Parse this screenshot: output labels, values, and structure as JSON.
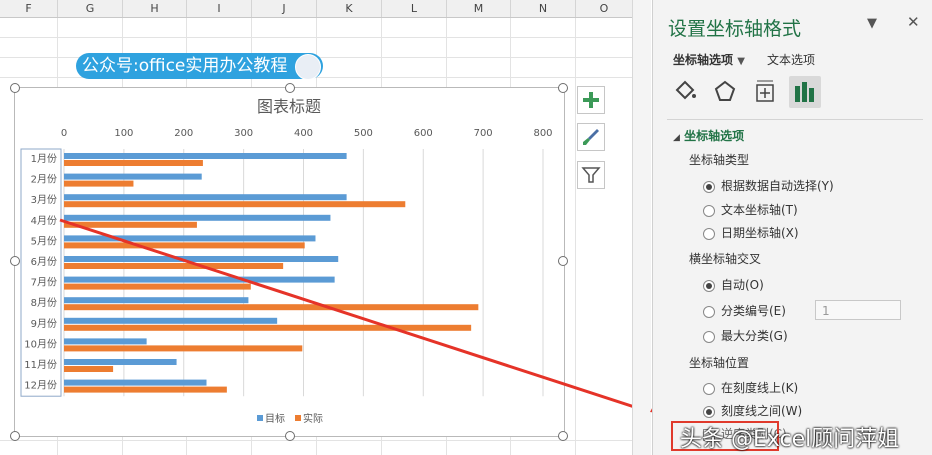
{
  "sheet": {
    "columns": [
      "F",
      "G",
      "H",
      "I",
      "J",
      "K",
      "L",
      "M",
      "N",
      "O"
    ]
  },
  "banner": {
    "text": "公众号:office实用办公教程"
  },
  "chart_data": {
    "type": "bar",
    "title": "图表标题",
    "categories": [
      "1月份",
      "2月份",
      "3月份",
      "4月份",
      "5月份",
      "6月份",
      "7月份",
      "8月份",
      "9月份",
      "10月份",
      "11月份",
      "12月份"
    ],
    "series": [
      {
        "name": "目标",
        "color": "#5b9bd5",
        "values": [
          472,
          230,
          472,
          445,
          420,
          458,
          452,
          308,
          356,
          138,
          188,
          238
        ]
      },
      {
        "name": "实际",
        "color": "#ed7d31",
        "values": [
          232,
          116,
          570,
          222,
          402,
          366,
          312,
          692,
          680,
          398,
          82,
          272
        ]
      }
    ],
    "xlim": [
      0,
      800
    ],
    "xticks": [
      0,
      100,
      200,
      300,
      400,
      500,
      600,
      700,
      800
    ],
    "grid": true,
    "legend_position": "bottom"
  },
  "chart_buttons": {
    "add_icon": "plus-icon",
    "style_icon": "brush-icon",
    "filter_icon": "filter-icon"
  },
  "panel": {
    "title": "设置坐标轴格式",
    "tab_axis": "坐标轴选项",
    "tab_text": "文本选项",
    "section": "坐标轴选项",
    "axis_type_label": "坐标轴类型",
    "axis_type_auto": "根据数据自动选择(Y)",
    "axis_type_text": "文本坐标轴(T)",
    "axis_type_date": "日期坐标轴(X)",
    "cross_label": "横坐标轴交叉",
    "cross_auto": "自动(O)",
    "cross_num": "分类编号(E)",
    "cross_num_value": "1",
    "cross_max": "最大分类(G)",
    "pos_label": "坐标轴位置",
    "pos_on": "在刻度线上(K)",
    "pos_between": "刻度线之间(W)",
    "pos_extra": "逆序类别(C)"
  },
  "watermark": {
    "text": "头条 @Excel顾问萍姐"
  }
}
